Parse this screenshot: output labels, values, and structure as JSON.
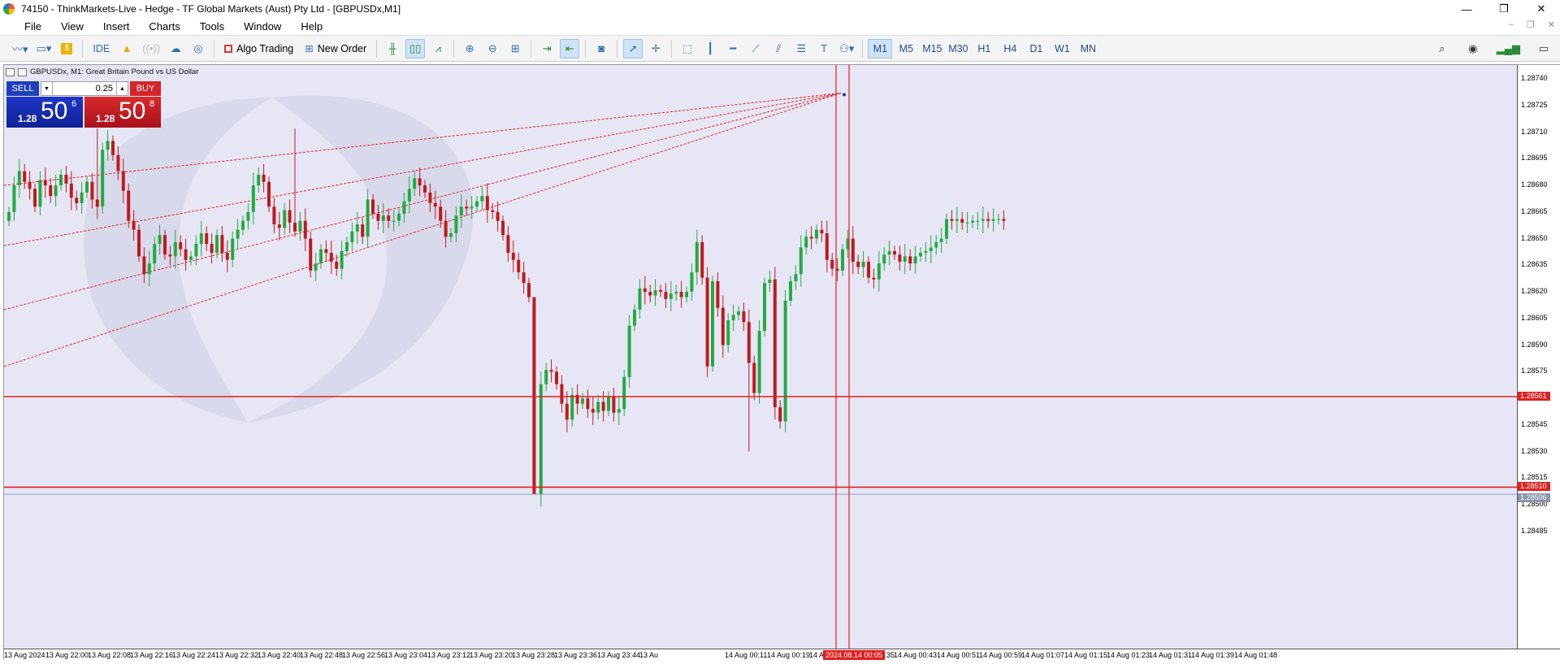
{
  "window": {
    "title": "74150 - ThinkMarkets-Live - Hedge - TF Global Markets (Aust) Pty Ltd - [GBPUSDx,M1]",
    "controls": [
      "—",
      "❐",
      "✕"
    ]
  },
  "menu": {
    "items": [
      "File",
      "View",
      "Insert",
      "Charts",
      "Tools",
      "Window",
      "Help"
    ]
  },
  "toolbar": {
    "ide_label": "IDE",
    "algo_label": "Algo Trading",
    "new_order_label": "New Order",
    "timeframes": [
      "M1",
      "M5",
      "M15",
      "M30",
      "H1",
      "H4",
      "D1",
      "W1",
      "MN"
    ],
    "active_timeframe": "M1"
  },
  "chart": {
    "info": "GBPUSDx, M1:  Great Britain Pound vs US Dollar",
    "trade": {
      "sell_label": "SELL",
      "buy_label": "BUY",
      "lot": "0.25",
      "sell_prefix": "1.28",
      "sell_big": "50",
      "sell_sup": "6",
      "buy_prefix": "1.28",
      "buy_big": "50",
      "buy_sup": "8"
    },
    "price_labels": [
      "1.28740",
      "1.28725",
      "1.28710",
      "1.28695",
      "1.28680",
      "1.28665",
      "1.28650",
      "1.28635",
      "1.28620",
      "1.28605",
      "1.28590",
      "1.28575",
      "1.28560",
      "1.28545",
      "1.28530",
      "1.28515",
      "1.28500",
      "1.28485"
    ],
    "price_tags": {
      "line1": "1.28561",
      "line2": "1.28510",
      "bid": "1.28506"
    },
    "time_labels": [
      "13 Aug 2024",
      "13 Aug 22:00",
      "13 Aug 22:08",
      "13 Aug 22:16",
      "13 Aug 22:24",
      "13 Aug 22:32",
      "13 Aug 22:40",
      "13 Aug 22:48",
      "13 Aug 22:56",
      "13 Aug 23:04",
      "13 Aug 23:12",
      "13 Aug 23:20",
      "13 Aug 23:28",
      "13 Aug 23:36",
      "13 Aug 23:44",
      "13 Au",
      "14 Aug 00:11",
      "14 Aug 00:19",
      "14 Aug 00:27",
      "14 Aug 00:35",
      "14 Aug 00:43",
      "14 Aug 00:51",
      "14 Aug 00:59",
      "14 Aug 01:07",
      "14 Aug 01:15",
      "14 Aug 01:23",
      "14 Aug 01:31",
      "14 Aug 01:39",
      "14 Aug 01:48"
    ],
    "crosshair_time": "2024.08.14 00:05",
    "colors": {
      "up": "#22aa44",
      "down": "#c0191f",
      "line": "#e0201f",
      "bg": "#e6e6f5"
    }
  },
  "chart_data": {
    "type": "candlestick",
    "symbol": "GBPUSDx",
    "timeframe": "M1",
    "ylim": [
      1.28475,
      1.28755
    ],
    "hlines": [
      1.28561,
      1.2851
    ],
    "anchor": [
      1.28732,
      1.28732
    ],
    "fan_targets": [
      1.2868,
      1.28643,
      1.28608,
      1.28577
    ],
    "closes": [
      1.28665,
      1.2868,
      1.28688,
      1.28682,
      1.28678,
      1.28668,
      1.28683,
      1.2868,
      1.28674,
      1.2868,
      1.28686,
      1.28681,
      1.28673,
      1.2867,
      1.28676,
      1.28682,
      1.28672,
      1.28668,
      1.287,
      1.28705,
      1.28697,
      1.28688,
      1.28677,
      1.2866,
      1.28655,
      1.2864,
      1.2863,
      1.28636,
      1.28647,
      1.28652,
      1.28641,
      1.2864,
      1.28648,
      1.28644,
      1.28638,
      1.2864,
      1.28647,
      1.28653,
      1.28647,
      1.28642,
      1.28652,
      1.28642,
      1.28638,
      1.2865,
      1.28655,
      1.2866,
      1.28665,
      1.2868,
      1.28686,
      1.28682,
      1.28668,
      1.28658,
      1.28656,
      1.28666,
      1.28659,
      1.28654,
      1.2866,
      1.2865,
      1.28632,
      1.28636,
      1.28644,
      1.28642,
      1.28637,
      1.28633,
      1.28643,
      1.28648,
      1.28654,
      1.28658,
      1.28651,
      1.28672,
      1.28664,
      1.2866,
      1.28663,
      1.2866,
      1.2866,
      1.28664,
      1.28671,
      1.28678,
      1.28684,
      1.2868,
      1.28676,
      1.2867,
      1.28668,
      1.2866,
      1.28651,
      1.28653,
      1.28663,
      1.28668,
      1.28667,
      1.28668,
      1.28671,
      1.28674,
      1.28666,
      1.28665,
      1.2866,
      1.28652,
      1.28642,
      1.28638,
      1.28631,
      1.28625,
      1.28617,
      1.28506,
      1.28568,
      1.28576,
      1.28575,
      1.28568,
      1.28557,
      1.28548,
      1.28562,
      1.28557,
      1.2856,
      1.28554,
      1.28552,
      1.28558,
      1.28553,
      1.28561,
      1.28552,
      1.28554,
      1.28572,
      1.28601,
      1.2861,
      1.28622,
      1.2862,
      1.28618,
      1.28621,
      1.2862,
      1.28616,
      1.28619,
      1.2862,
      1.28617,
      1.2862,
      1.28631,
      1.28648,
      1.28628,
      1.28578,
      1.28626,
      1.28611,
      1.2859,
      1.28604,
      1.28607,
      1.28609,
      1.28603,
      1.2858,
      1.28563,
      1.28598,
      1.28625,
      1.28627,
      1.28555,
      1.28547,
      1.28615,
      1.28626,
      1.2863,
      1.28645,
      1.28651,
      1.2865,
      1.28655,
      1.28653,
      1.28638,
      1.28633,
      1.28632,
      1.28644,
      1.2865,
      1.28637,
      1.28634,
      1.28637,
      1.28628,
      1.28627,
      1.28636,
      1.28641,
      1.28643,
      1.28641,
      1.28637,
      1.2864,
      1.28636,
      1.2864,
      1.28642,
      1.28643,
      1.28645,
      1.28648,
      1.2865,
      1.28661,
      1.2866,
      1.28661,
      1.28659,
      1.28659,
      1.2866,
      1.2866,
      1.28661,
      1.2866,
      1.28661,
      1.28661,
      1.2866
    ]
  }
}
